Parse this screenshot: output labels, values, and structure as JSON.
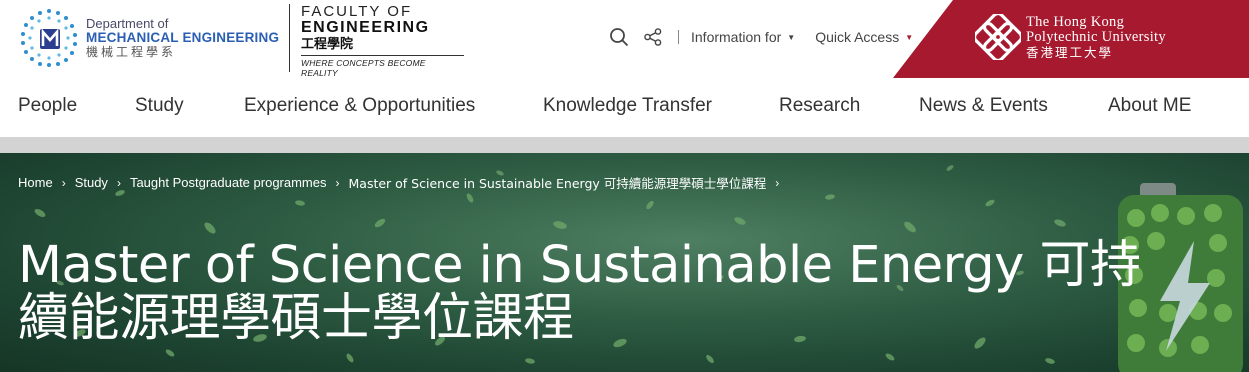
{
  "header": {
    "dept_logo": {
      "line1": "Department of",
      "line2": "MECHANICAL ENGINEERING",
      "line3": "機械工程學系"
    },
    "faculty_logo": {
      "line1": "FACULTY OF",
      "line2": "ENGINEERING",
      "line3": "工程學院",
      "tagline": "WHERE CONCEPTS BECOME REALITY"
    },
    "utilities": {
      "search_icon": "search-icon",
      "share_icon": "share-icon",
      "information_for": "Information for",
      "quick_access": "Quick Access"
    },
    "university": {
      "line1": "The Hong Kong",
      "line2": "Polytechnic University",
      "line3": "香港理工大學"
    }
  },
  "nav": {
    "items": [
      {
        "label": "People"
      },
      {
        "label": "Study"
      },
      {
        "label": "Experience & Opportunities"
      },
      {
        "label": "Knowledge Transfer"
      },
      {
        "label": "Research"
      },
      {
        "label": "News & Events"
      },
      {
        "label": "About ME"
      }
    ]
  },
  "breadcrumb": {
    "items": [
      {
        "label": "Home"
      },
      {
        "label": "Study"
      },
      {
        "label": "Taught Postgraduate programmes"
      },
      {
        "label": "Master of Science in Sustainable Energy 可持續能源理學碩士學位課程"
      }
    ]
  },
  "hero": {
    "title_line1": "Master of Science in Sustainable Energy 可持",
    "title_line2": "續能源理學碩士學位課程"
  },
  "colors": {
    "brand_red": "#a6192e",
    "me_blue": "#2b5fb4",
    "hero_green": "#2f5e44"
  }
}
